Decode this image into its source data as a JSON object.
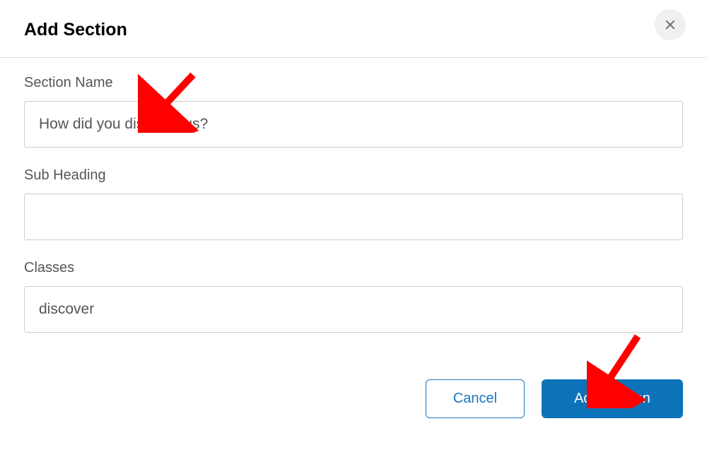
{
  "dialog": {
    "title": "Add Section",
    "fields": {
      "section_name": {
        "label": "Section Name",
        "value": "How did you discover us?"
      },
      "sub_heading": {
        "label": "Sub Heading",
        "value": ""
      },
      "classes": {
        "label": "Classes",
        "value": "discover"
      }
    },
    "buttons": {
      "cancel": "Cancel",
      "submit": "Add Section"
    }
  }
}
